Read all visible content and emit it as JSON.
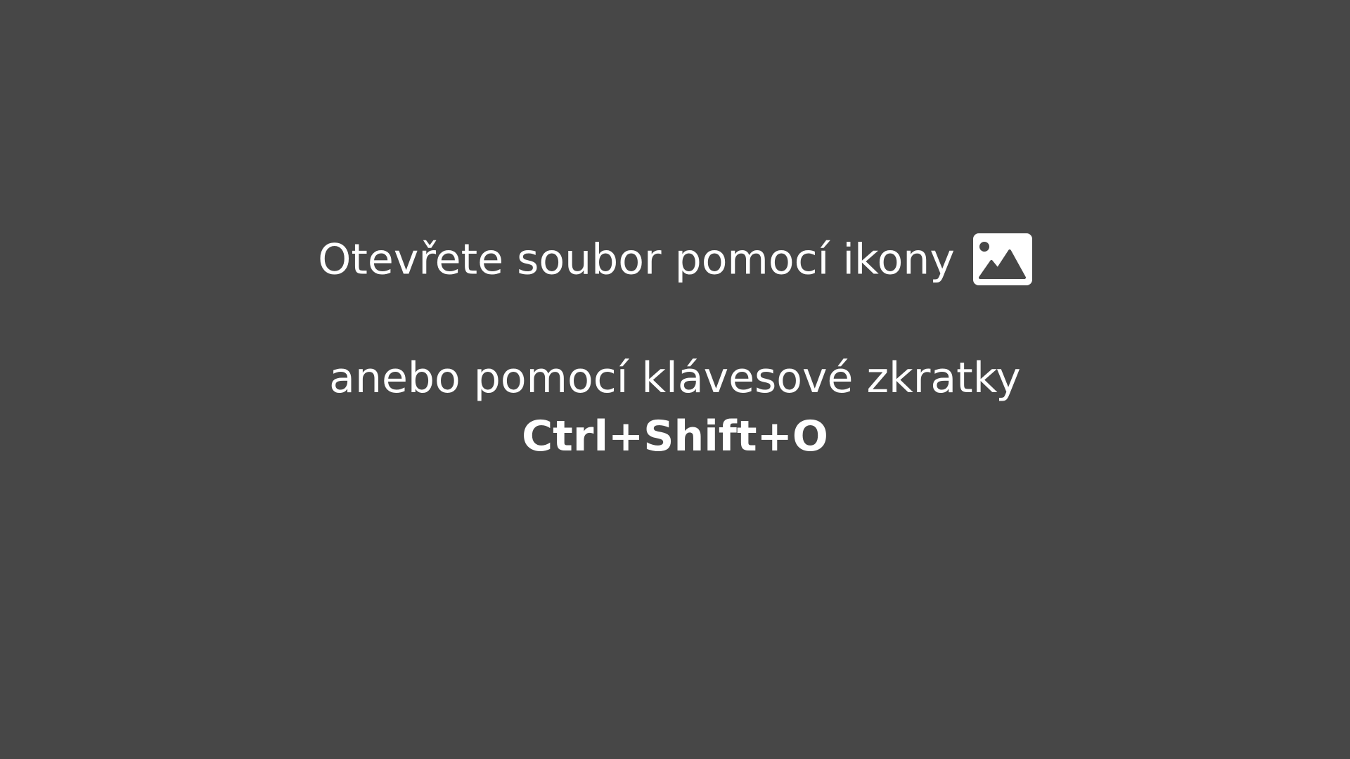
{
  "empty_state": {
    "open_prompt": "Otevřete soubor pomocí ikony",
    "open_icon": "image-icon",
    "shortcut_prompt": "anebo pomocí klávesové zkratky",
    "shortcut": "Ctrl+Shift+O"
  },
  "colors": {
    "background": "#474747",
    "text": "#ffffff"
  }
}
